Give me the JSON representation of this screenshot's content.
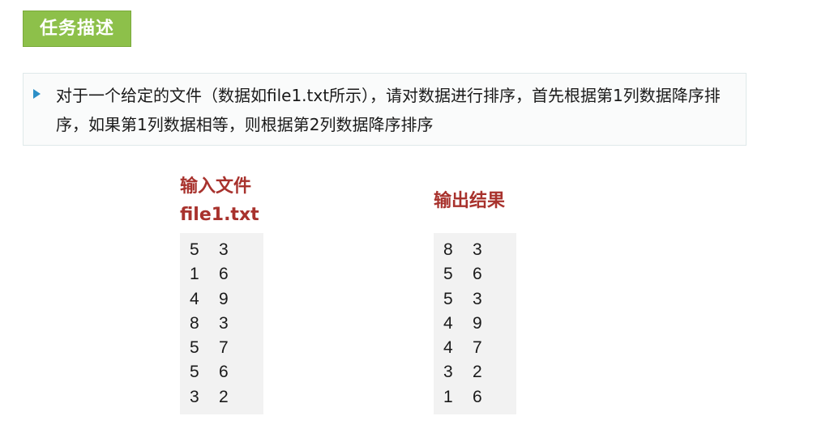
{
  "header": {
    "title": "任务描述"
  },
  "description": {
    "text": "对于一个给定的文件（数据如file1.txt所示），请对数据进行排序，首先根据第1列数据降序排序，如果第1列数据相等，则根据第2列数据降序排序"
  },
  "input": {
    "heading": "输入文件",
    "filename": "file1.txt",
    "rows": [
      [
        "5",
        "3"
      ],
      [
        "1",
        "6"
      ],
      [
        "4",
        "9"
      ],
      [
        "8",
        "3"
      ],
      [
        "5",
        "7"
      ],
      [
        "5",
        "6"
      ],
      [
        "3",
        "2"
      ]
    ]
  },
  "output": {
    "heading": "输出结果",
    "rows": [
      [
        "8",
        "3"
      ],
      [
        "5",
        "6"
      ],
      [
        "5",
        "3"
      ],
      [
        "4",
        "9"
      ],
      [
        "4",
        "7"
      ],
      [
        "3",
        "2"
      ],
      [
        "1",
        "6"
      ]
    ]
  }
}
